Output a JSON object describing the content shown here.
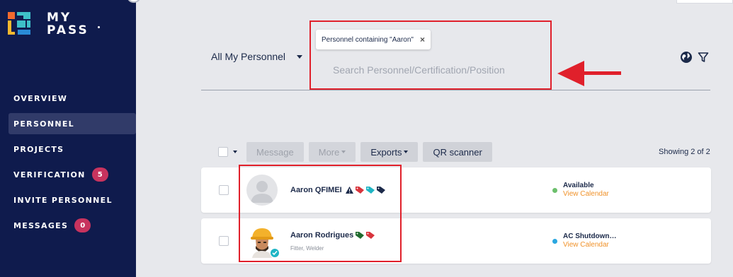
{
  "app": {
    "logo_line1": "MY",
    "logo_line2": "PASS"
  },
  "sidebar": {
    "items": [
      {
        "label": "OVERVIEW"
      },
      {
        "label": "PERSONNEL"
      },
      {
        "label": "PROJECTS"
      },
      {
        "label": "VERIFICATION",
        "badge": "5"
      },
      {
        "label": "INVITE PERSONNEL"
      },
      {
        "label": "MESSAGES",
        "badge": "0"
      }
    ],
    "active_item": "PERSONNEL"
  },
  "filter": {
    "dropdown_value": "All My Personnel",
    "chip_label": "Personnel containing \"Aaron\"",
    "chip_close": "×",
    "search_placeholder": "Search Personnel/Certification/Position"
  },
  "toolbar": {
    "message_label": "Message",
    "more_label": "More",
    "exports_label": "Exports",
    "qr_label": "QR scanner",
    "showing_text": "Showing 2 of 2"
  },
  "personnel": [
    {
      "name": "Aaron QFIMEI",
      "subtitle": "",
      "status": "Available",
      "status_color": "#6cbf6c",
      "calendar_link": "View Calendar",
      "tags": [
        "warning",
        "red",
        "teal",
        "navy"
      ]
    },
    {
      "name": "Aaron Rodrigues",
      "subtitle": "Fitter, Welder",
      "status": "AC Shutdown…",
      "status_color": "#2aa7e0",
      "calendar_link": "View Calendar",
      "tags": [
        "green",
        "red"
      ],
      "verified": true
    }
  ],
  "colors": {
    "sidebar_bg": "#0f1b4d",
    "accent_orange": "#f0922a",
    "badge": "#c8335e",
    "annotation_red": "#e0202b"
  },
  "icons": [
    "globe-icon",
    "filter-icon",
    "close-icon",
    "chevron-down-icon",
    "tag-icon",
    "warning-icon",
    "verified-icon"
  ]
}
